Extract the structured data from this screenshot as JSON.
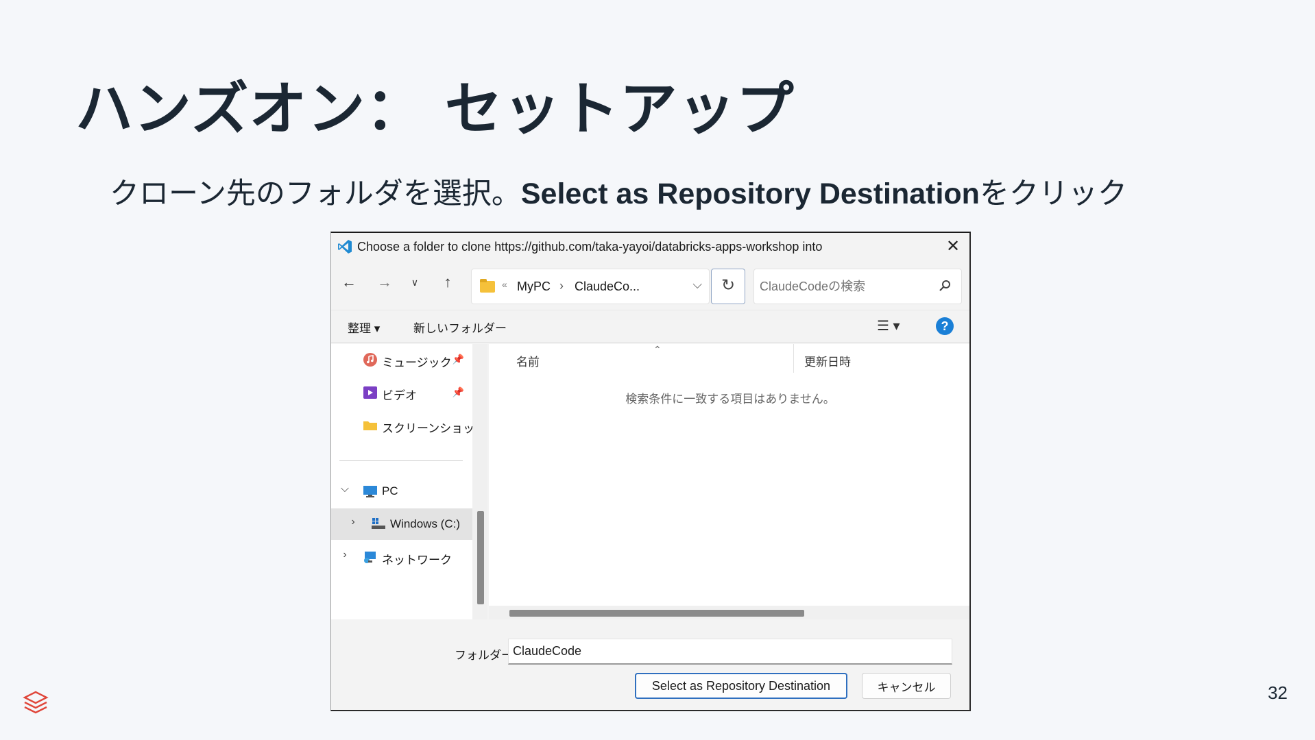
{
  "slide": {
    "title": "ハンズオン： セットアップ",
    "subtitle_pre": "クローン先のフォルダを選択。",
    "subtitle_bold": "Select as Repository Destination",
    "subtitle_post": "をクリック",
    "page_number": "32"
  },
  "dialog": {
    "title": "Choose a folder to clone https://github.com/taka-yayoi/databricks-apps-workshop into",
    "address": {
      "overflow": "«",
      "segments": [
        "MyPC",
        "ClaudeCo..."
      ],
      "separator": "›"
    },
    "search": {
      "placeholder": "ClaudeCodeの検索"
    },
    "commands": {
      "organize": "整理 ▾",
      "new_folder": "新しいフォルダー",
      "view": "☰ ▾",
      "help": "?"
    },
    "nav_items": [
      {
        "label": "ミュージック",
        "icon": "music-icon"
      },
      {
        "label": "ビデオ",
        "icon": "video-icon"
      },
      {
        "label": "スクリーンショット",
        "icon": "folder-icon"
      },
      {
        "label": "PC",
        "icon": "pc-icon"
      },
      {
        "label": "Windows (C:)",
        "icon": "drive-icon"
      },
      {
        "label": "ネットワーク",
        "icon": "network-icon"
      }
    ],
    "columns": {
      "name": "名前",
      "date": "更新日時"
    },
    "empty_message": "検索条件に一致する項目はありません。",
    "folder_label": "フォルダー:",
    "folder_value": "ClaudeCode",
    "select_button": "Select as Repository Destination",
    "cancel_button": "キャンセル"
  },
  "colors": {
    "accent": "#1a7fd6",
    "primary_border": "#2f6fbf",
    "slide_text": "#1b2733"
  }
}
